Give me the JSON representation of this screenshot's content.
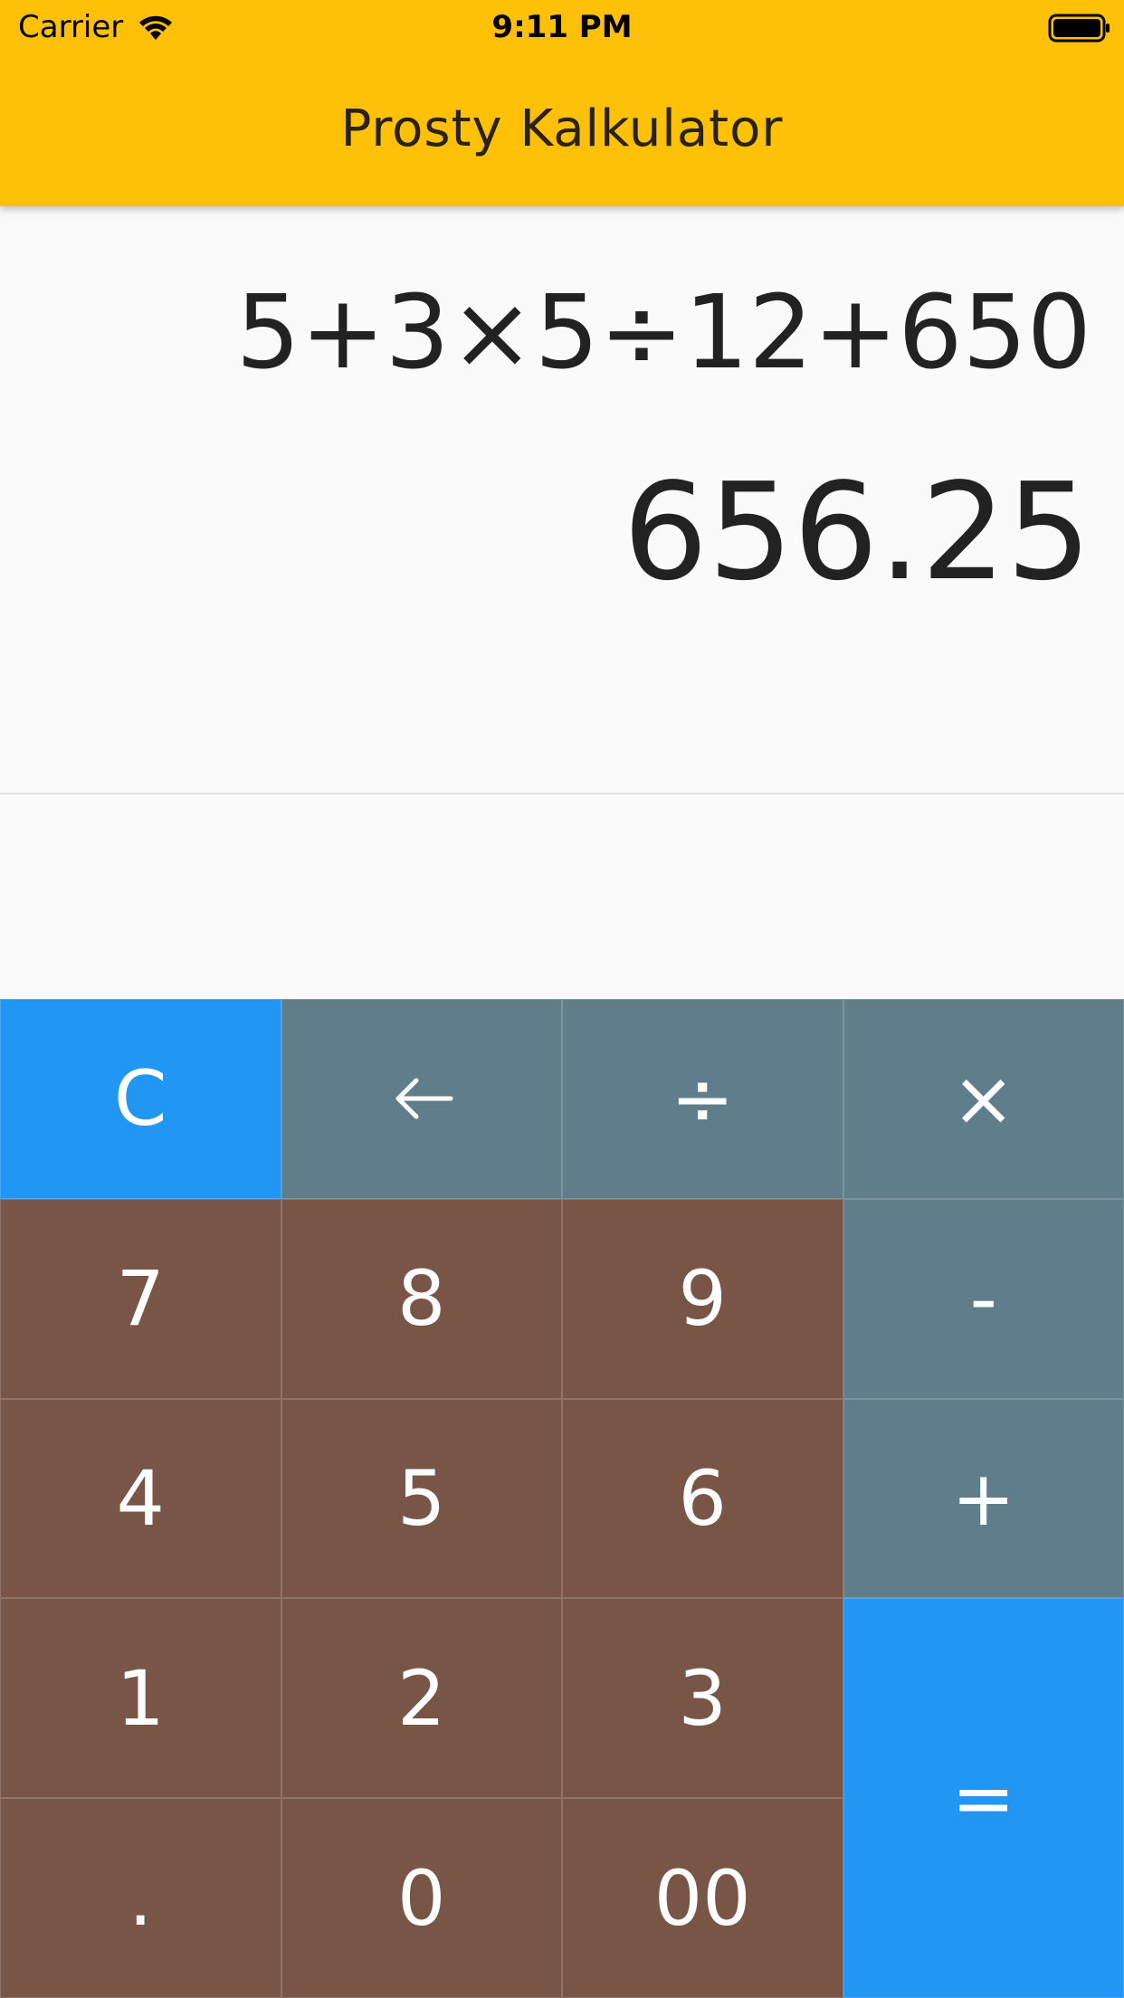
{
  "status_bar": {
    "carrier": "Carrier",
    "time": "9:11 PM",
    "wifi_icon": "wifi-icon",
    "battery_icon": "battery-icon"
  },
  "app_bar": {
    "title": "Prosty Kalkulator",
    "color": "#ffc107"
  },
  "display": {
    "expression": "5+3×5÷12+650",
    "result": "656.25"
  },
  "keypad": {
    "colors": {
      "digit": "#795548",
      "operator": "#607d8b",
      "accent": "#2196f3"
    },
    "keys": {
      "clear": "C",
      "backspace_icon": "arrow-left-icon",
      "divide": "÷",
      "multiply": "×",
      "seven": "7",
      "eight": "8",
      "nine": "9",
      "minus": "-",
      "four": "4",
      "five": "5",
      "six": "6",
      "plus": "+",
      "one": "1",
      "two": "2",
      "three": "3",
      "equals": "=",
      "decimal": ".",
      "zero": "0",
      "double_zero": "00"
    }
  }
}
